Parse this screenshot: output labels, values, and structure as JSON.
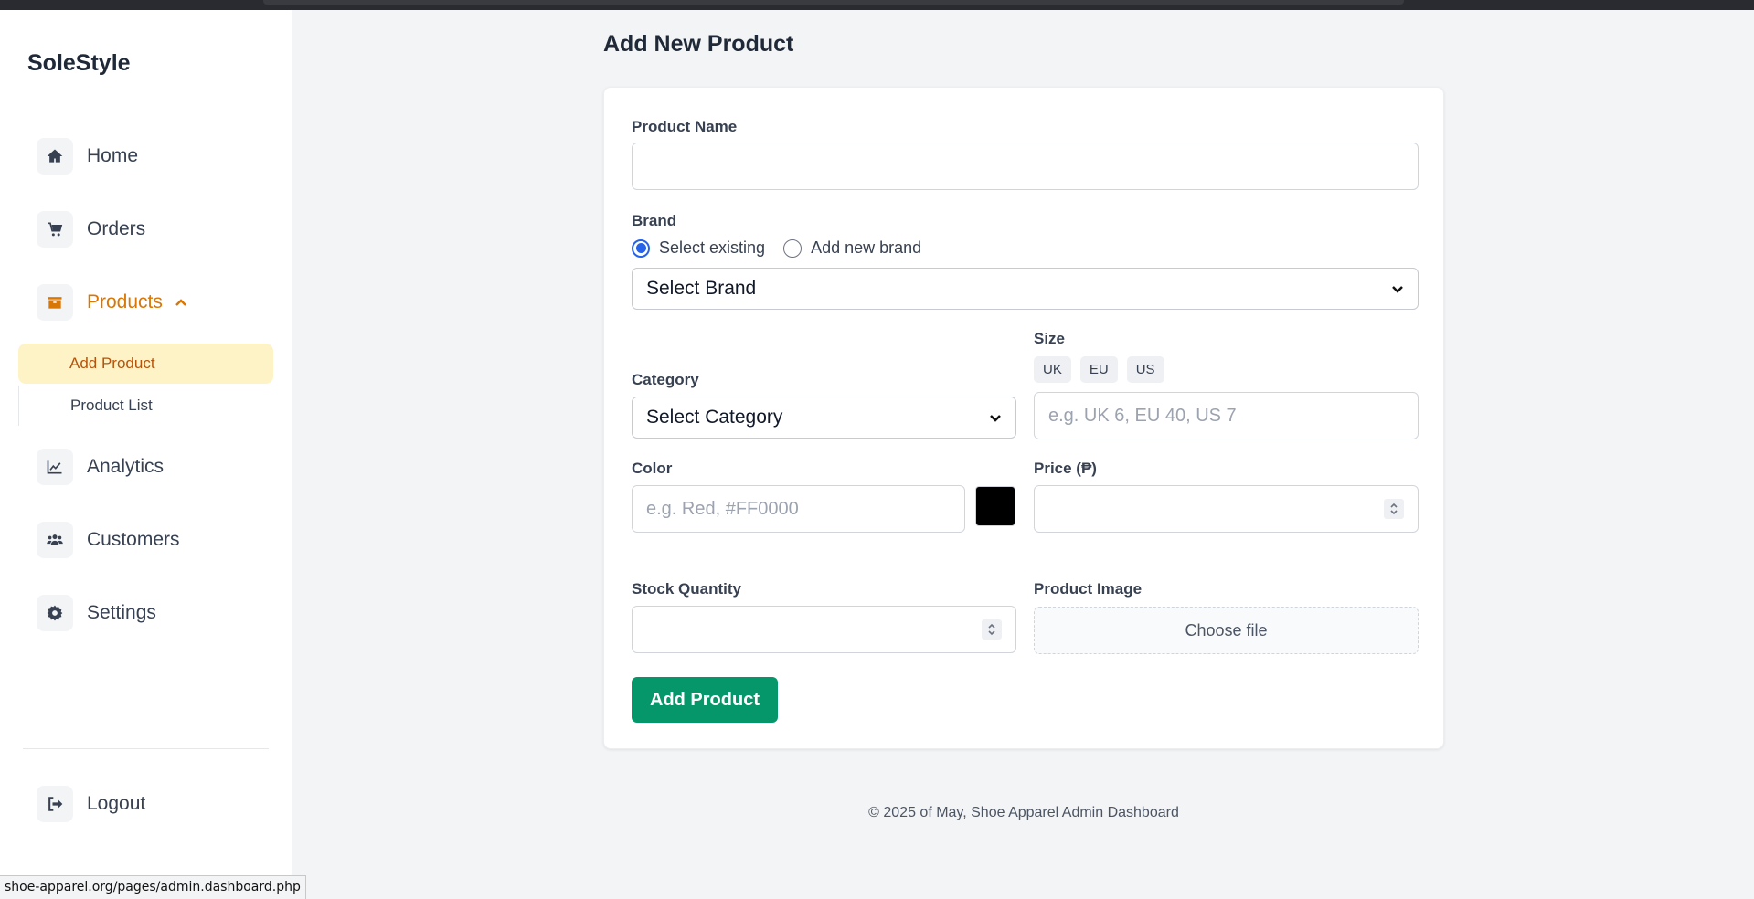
{
  "browser": {
    "status_url": "shoe-apparel.org/pages/admin.dashboard.php"
  },
  "sidebar": {
    "brand": "SoleStyle",
    "items": [
      {
        "label": "Home",
        "icon": "home-icon"
      },
      {
        "label": "Orders",
        "icon": "cart-icon"
      },
      {
        "label": "Products",
        "icon": "box-icon",
        "active": true,
        "expanded": true
      },
      {
        "label": "Analytics",
        "icon": "chart-line-icon"
      },
      {
        "label": "Customers",
        "icon": "users-icon"
      },
      {
        "label": "Settings",
        "icon": "gear-icon"
      }
    ],
    "sub_items": [
      {
        "label": "Add Product",
        "selected": true
      },
      {
        "label": "Product List"
      }
    ],
    "logout": {
      "label": "Logout",
      "icon": "sign-out-icon"
    }
  },
  "page": {
    "title": "Add New Product"
  },
  "form": {
    "product_name": {
      "label": "Product Name",
      "value": "",
      "placeholder": ""
    },
    "brand": {
      "label": "Brand",
      "options": [
        "Select existing",
        "Add new brand"
      ],
      "selected_option": "Select existing",
      "select_value": "Select Brand"
    },
    "category": {
      "label": "Category",
      "select_value": "Select Category"
    },
    "size": {
      "label": "Size",
      "tags": [
        "UK",
        "EU",
        "US"
      ],
      "placeholder": "e.g. UK 6, EU 40, US 7"
    },
    "color": {
      "label": "Color",
      "placeholder": "e.g. Red, #FF0000",
      "swatch": "#000000"
    },
    "price": {
      "label": "Price (₱)",
      "value": ""
    },
    "stock": {
      "label": "Stock Quantity",
      "value": ""
    },
    "image": {
      "label": "Product Image",
      "button": "Choose file"
    },
    "submit": "Add Product"
  },
  "colors": {
    "accent": "#d97706",
    "submit": "#059669",
    "radio": "#2563eb"
  },
  "footer": "© 2025 of May, Shoe Apparel Admin Dashboard"
}
